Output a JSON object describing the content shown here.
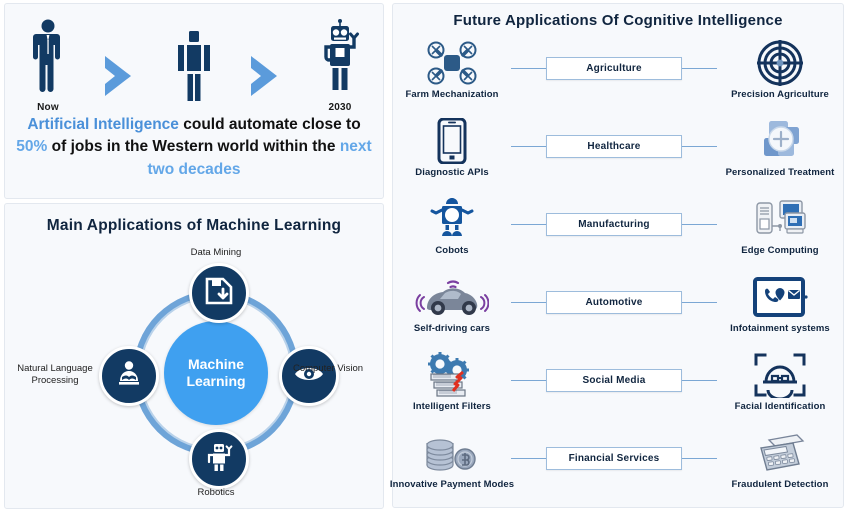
{
  "left_top": {
    "timeline": [
      {
        "caption": "Now",
        "icon": "human-figure-icon"
      },
      {
        "caption": "",
        "icon": "chevron-right-icon"
      },
      {
        "caption": "",
        "icon": "android-figure-icon"
      },
      {
        "caption": "",
        "icon": "chevron-right-icon"
      },
      {
        "caption": "2030",
        "icon": "robot-figure-icon"
      }
    ],
    "headline": {
      "part1": "Artificial Intelligence",
      "part2": " could automate close to ",
      "part3": "50%",
      "part4": " of jobs in the Western world within the ",
      "part5": "next two decades"
    }
  },
  "left_bottom": {
    "title": "Main Applications of Machine Learning",
    "hub_line1": "Machine",
    "hub_line2": "Learning",
    "nodes": [
      {
        "label": "Data Mining",
        "icon": "save-download-icon",
        "position": "top"
      },
      {
        "label": "Natural Language Processing",
        "icon": "person-reading-icon",
        "position": "left"
      },
      {
        "label": "Computer Vision",
        "icon": "eye-icon",
        "position": "right"
      },
      {
        "label": "Robotics",
        "icon": "robot-icon",
        "position": "bottom"
      }
    ]
  },
  "right": {
    "title": "Future Applications Of Cognitive Intelligence",
    "rows": [
      {
        "domain": "Agriculture",
        "left_label": "Farm Mechanization",
        "left_icon": "drone-icon",
        "right_label": "Precision Agriculture",
        "right_icon": "target-icon"
      },
      {
        "domain": "Healthcare",
        "left_label": "Diagnostic  APIs",
        "left_icon": "smartphone-icon",
        "right_label": "Personalized Treatment",
        "right_icon": "medical-plus-icon"
      },
      {
        "domain": "Manufacturing",
        "left_label": "Cobots",
        "left_icon": "cobot-robot-icon",
        "right_label": "Edge Computing",
        "right_icon": "server-computers-icon"
      },
      {
        "domain": "Automotive",
        "left_label": "Self-driving cars",
        "left_icon": "car-signal-icon",
        "right_label": "Infotainment systems",
        "right_icon": "tablet-apps-icon"
      },
      {
        "domain": "Social  Media",
        "left_label": "Intelligent Filters",
        "left_icon": "gears-filter-icon",
        "right_label": "Facial Identification",
        "right_icon": "face-scan-icon"
      },
      {
        "domain": "Financial  Services",
        "left_label": "Innovative  Payment Modes",
        "left_icon": "coins-stack-icon",
        "right_label": "Fraudulent Detection",
        "right_icon": "calculator-icon"
      }
    ]
  },
  "colors": {
    "navy": "#123a63",
    "dark_navy": "#10253f",
    "bright_blue": "#3fa0f0",
    "mid_blue": "#4a90d9",
    "light_blue": "#7ba7d4",
    "panel_bg": "#f7f9fc"
  }
}
